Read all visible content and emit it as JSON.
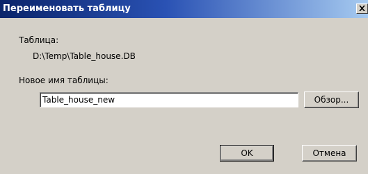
{
  "window": {
    "title": "Переименовать таблицу",
    "close_icon": "close-icon"
  },
  "form": {
    "table_label": "Таблица:",
    "table_path": "D:\\Temp\\Table_house.DB",
    "new_name_label": "Новое имя таблицы:",
    "new_name_value": "Table_house_new",
    "browse_label": "Обзор..."
  },
  "buttons": {
    "ok_label": "OK",
    "cancel_label": "Отмена"
  }
}
